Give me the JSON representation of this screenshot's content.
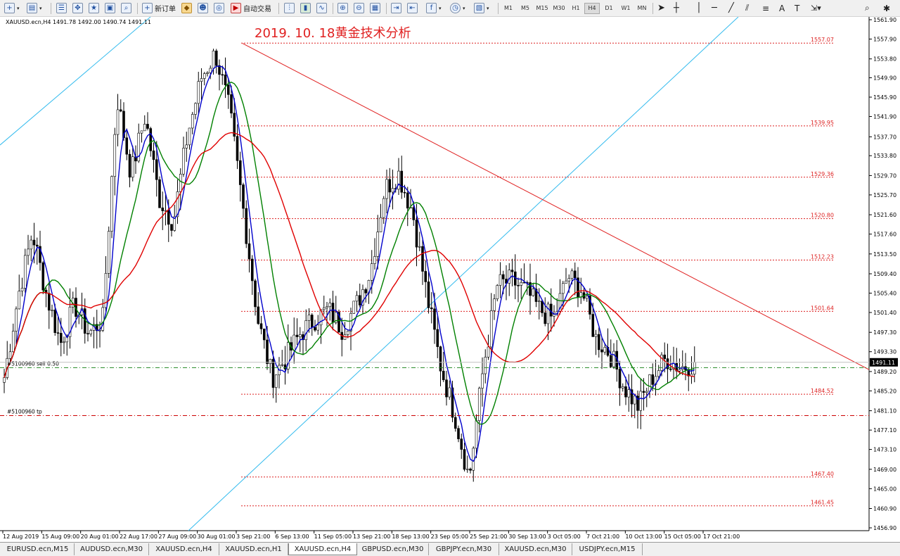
{
  "toolbar": {
    "new_order_label": "新订单",
    "auto_trade_label": "自动交易",
    "timeframes": [
      "M1",
      "M5",
      "M15",
      "M30",
      "H1",
      "H4",
      "D1",
      "W1",
      "MN"
    ],
    "active_timeframe": "H4",
    "text_tool_label": "A",
    "icons": [
      "new-chart-icon",
      "profiles-icon",
      "market-watch-icon",
      "navigator-icon",
      "crosshair-icon",
      "terminal-icon",
      "tester-icon",
      "metaeditor-icon",
      "bar-chart-icon",
      "candle-chart-icon",
      "line-chart-icon",
      "zoom-in-icon",
      "zoom-out-icon",
      "tile-icon",
      "autoscroll-icon",
      "chart-shift-icon",
      "indicators-icon",
      "period-icon",
      "templates-icon",
      "cursor-icon",
      "crosshair-tool-icon",
      "vertical-line-icon",
      "horizontal-line-icon",
      "trendline-icon",
      "channel-icon",
      "fibonacci-icon",
      "label-icon",
      "arrows-icon",
      "search-icon",
      "settings-icon"
    ]
  },
  "chart": {
    "header": "XAUUSD.ecn,H4  1491.78 1492.00 1490.74 1491.11",
    "annotation": "2019. 10. 18黄金技术分析",
    "current_price_label": "1491.11",
    "order_labels": [
      "#5100960 sell 0.50",
      "#5100960 tp"
    ],
    "colors": {
      "ma_fast": "#0000cc",
      "ma_mid": "#008000",
      "ma_slow": "#e00000",
      "channel": "#33bbee",
      "level": "#dd2222",
      "bull": "#ffffff",
      "bear": "#000000",
      "order": "#228822",
      "tp": "#cc0000"
    }
  },
  "chart_data": {
    "type": "candlestick",
    "symbol": "XAUUSD.ecn",
    "timeframe": "H4",
    "ylim": [
      1456.9,
      1561.9
    ],
    "y_ticks": [
      1561.9,
      1557.9,
      1553.8,
      1549.9,
      1545.9,
      1541.9,
      1537.7,
      1533.8,
      1529.7,
      1525.7,
      1521.6,
      1517.6,
      1513.5,
      1509.4,
      1505.4,
      1501.4,
      1497.3,
      1493.3,
      1489.2,
      1485.2,
      1481.1,
      1477.1,
      1473.1,
      1469.0,
      1465.0,
      1460.9,
      1456.9
    ],
    "x_labels": [
      "12 Aug 2019",
      "15 Aug 09:00",
      "20 Aug 01:00",
      "22 Aug 17:00",
      "27 Aug 09:00",
      "30 Aug 01:00",
      "3 Sep 21:00",
      "6 Sep 13:00",
      "11 Sep 05:00",
      "13 Sep 21:00",
      "18 Sep 13:00",
      "23 Sep 05:00",
      "25 Sep 21:00",
      "30 Sep 13:00",
      "3 Oct 05:00",
      "7 Oct 21:00",
      "10 Oct 13:00",
      "15 Oct 05:00",
      "17 Oct 21:00"
    ],
    "price_path": [
      1488,
      1505,
      1518,
      1505,
      1495,
      1503,
      1497,
      1500,
      1546,
      1530,
      1542,
      1525,
      1520,
      1538,
      1550,
      1555,
      1543,
      1522,
      1500,
      1488,
      1492,
      1497,
      1500,
      1502,
      1498,
      1503,
      1510,
      1527,
      1530,
      1522,
      1505,
      1490,
      1480,
      1467,
      1490,
      1507,
      1508,
      1506,
      1502,
      1500,
      1509,
      1506,
      1496,
      1493,
      1486,
      1482,
      1488,
      1492,
      1490,
      1491.1
    ],
    "fib_levels": [
      1557.07,
      1539.95,
      1529.36,
      1520.8,
      1512.23,
      1501.64,
      1484.52,
      1467.4,
      1461.45
    ],
    "order_lines": [
      {
        "label": "#5100960 sell 0.50",
        "price": 1490.0
      },
      {
        "label": "#5100960 tp",
        "price": 1480.1
      }
    ],
    "current_price": 1491.11,
    "trend_line": {
      "from": [
        "3 Sep 21:00",
        1557.0
      ],
      "to": [
        "17 Oct 21:00",
        1489.5
      ]
    },
    "channel_lines": [
      {
        "from": [
          1536.0
        ],
        "to": [
          1561.9
        ]
      },
      {
        "from": [
          1456.9
        ],
        "to": [
          1561.9
        ]
      }
    ],
    "series": [
      {
        "values": "ma_fast"
      },
      {
        "values": "ma_mid"
      },
      {
        "values": "ma_slow"
      }
    ]
  },
  "tabs": [
    "EURUSD.ecn,M15",
    "AUDUSD.ecn,M30",
    "XAUUSD.ecn,H4",
    "XAUUSD.ecn,H1",
    "XAUUSD.ecn,H4",
    "GBPUSD.ecn,M30",
    "GBPJPY.ecn,M30",
    "XAUUSD.ecn,M30",
    "USDJPY.ecn,M15"
  ],
  "active_tab_index": 4
}
